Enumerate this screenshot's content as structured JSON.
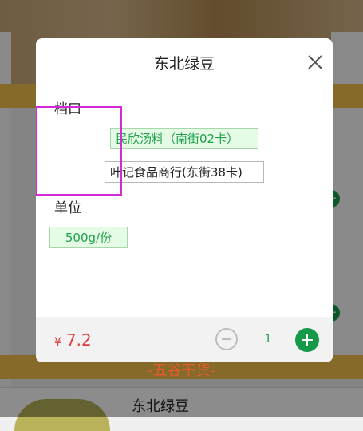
{
  "background": {
    "category_band": "-五谷干货-",
    "next_item_title": "东北绿豆"
  },
  "modal": {
    "title": "东北绿豆",
    "stall_section_label": "档口",
    "stalls": [
      {
        "label": "民欣汤料（南街02卡）",
        "selected": true
      },
      {
        "label": "叶记食品商行(东街38卡)",
        "selected": false
      }
    ],
    "unit_section_label": "单位",
    "unit_option": "500g/份",
    "currency": "¥",
    "price": "7.2",
    "quantity": "1"
  },
  "colors": {
    "accent_green": "#159a48",
    "price_red": "#e03c3c",
    "highlight_magenta": "#d22ad6"
  }
}
